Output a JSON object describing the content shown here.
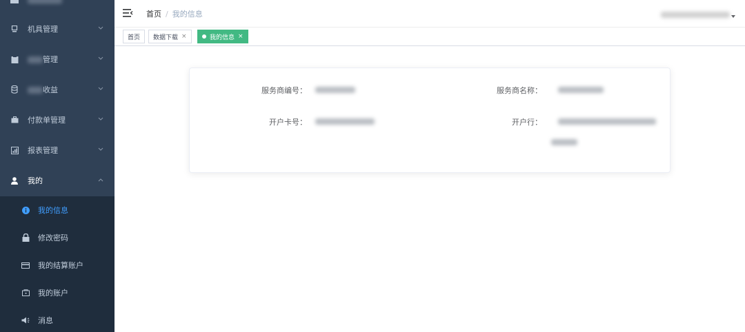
{
  "sidebar": {
    "items": [
      {
        "label": "机具管理"
      },
      {
        "label": "管理"
      },
      {
        "label": "收益"
      },
      {
        "label": "付款单管理"
      },
      {
        "label": "报表管理"
      },
      {
        "label": "我的"
      }
    ],
    "submenu": [
      {
        "label": "我的信息"
      },
      {
        "label": "修改密码"
      },
      {
        "label": "我的结算账户"
      },
      {
        "label": "我的账户"
      },
      {
        "label": "消息"
      }
    ]
  },
  "header": {
    "breadcrumb": {
      "home": "首页",
      "separator": "/",
      "current": "我的信息"
    }
  },
  "tags": [
    {
      "label": "首页"
    },
    {
      "label": "数据下载",
      "close": "×"
    },
    {
      "label": "我的信息",
      "close": "×"
    }
  ],
  "info": {
    "provider_id_label": "服务商编号：",
    "provider_name_label": "服务商名称：",
    "card_no_label": "开户卡号：",
    "bank_label": "开户行："
  },
  "colors": {
    "sidebar_bg": "#304156",
    "submenu_bg": "#1f2d3d",
    "active_link": "#409eff",
    "active_tag": "#42b983"
  }
}
